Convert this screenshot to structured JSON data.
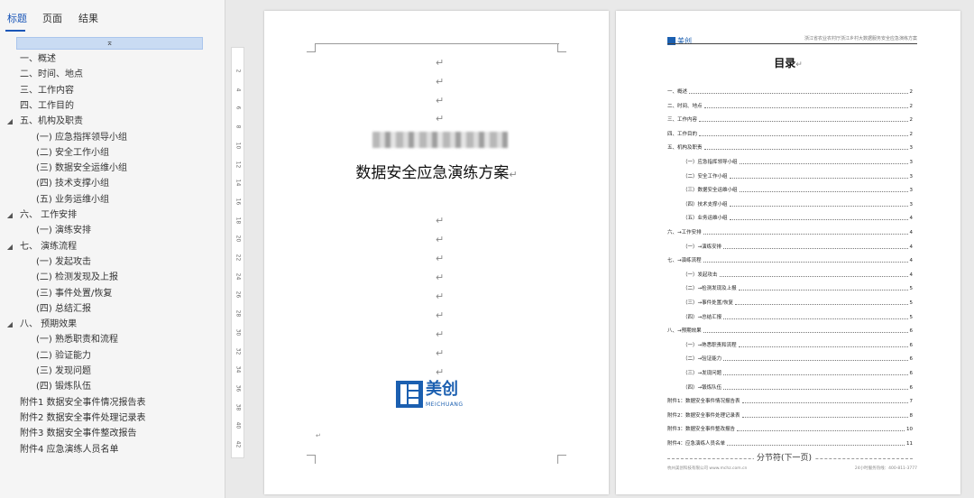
{
  "nav": {
    "tabs": [
      {
        "label": "标题",
        "active": true
      },
      {
        "label": "页面",
        "active": false
      },
      {
        "label": "结果",
        "active": false
      }
    ],
    "collapse_label": "⌅",
    "items": [
      {
        "label": "一、概述",
        "level": 0,
        "arrow": ""
      },
      {
        "label": "二、时间、地点",
        "level": 0,
        "arrow": ""
      },
      {
        "label": "三、工作内容",
        "level": 0,
        "arrow": ""
      },
      {
        "label": "四、工作目的",
        "level": 0,
        "arrow": ""
      },
      {
        "label": "五、机构及职责",
        "level": 0,
        "arrow": "◢"
      },
      {
        "label": "(一) 应急指挥领导小组",
        "level": 1,
        "arrow": ""
      },
      {
        "label": "(二) 安全工作小组",
        "level": 1,
        "arrow": ""
      },
      {
        "label": "(三) 数据安全运维小组",
        "level": 1,
        "arrow": ""
      },
      {
        "label": "(四) 技术支撑小组",
        "level": 1,
        "arrow": ""
      },
      {
        "label": "(五) 业务运维小组",
        "level": 1,
        "arrow": ""
      },
      {
        "label": "六、 工作安排",
        "level": 0,
        "arrow": "◢"
      },
      {
        "label": "(一)  演练安排",
        "level": 1,
        "arrow": ""
      },
      {
        "label": "七、 演练流程",
        "level": 0,
        "arrow": "◢"
      },
      {
        "label": "(一) 发起攻击",
        "level": 1,
        "arrow": ""
      },
      {
        "label": "(二)  检测发现及上报",
        "level": 1,
        "arrow": ""
      },
      {
        "label": "(三)  事件处置/恢复",
        "level": 1,
        "arrow": ""
      },
      {
        "label": "(四)  总结汇报",
        "level": 1,
        "arrow": ""
      },
      {
        "label": "八、 预期效果",
        "level": 0,
        "arrow": "◢"
      },
      {
        "label": "(一)  熟悉职责和流程",
        "level": 1,
        "arrow": ""
      },
      {
        "label": "(二) 验证能力",
        "level": 1,
        "arrow": ""
      },
      {
        "label": "(三)  发现问题",
        "level": 1,
        "arrow": ""
      },
      {
        "label": "(四)  锻炼队伍",
        "level": 1,
        "arrow": ""
      },
      {
        "label": "附件1 数据安全事件情况报告表",
        "level": 0,
        "arrow": ""
      },
      {
        "label": "附件2 数据安全事件处理记录表",
        "level": 0,
        "arrow": ""
      },
      {
        "label": "附件3 数据安全事件整改报告",
        "level": 0,
        "arrow": ""
      },
      {
        "label": "附件4 应急演练人员名单",
        "level": 0,
        "arrow": ""
      }
    ]
  },
  "ruler": {
    "numbers": [
      "2",
      "4",
      "6",
      "8",
      "10",
      "12",
      "14",
      "16",
      "18",
      "20",
      "22",
      "24",
      "26",
      "28",
      "30",
      "32",
      "34",
      "36",
      "38",
      "40",
      "42"
    ]
  },
  "page1": {
    "para_mark": "↵",
    "title": "数据安全应急演练方案",
    "logo_text": "美创",
    "logo_sub": "MEICHUANG"
  },
  "page2": {
    "logo_text": "美创",
    "header_text": "浙江省农业农村厅浙江乡村大数据服务安全应急演练方案",
    "toc_title": "目录",
    "toc": [
      {
        "label": "一、概述",
        "page": "2"
      },
      {
        "label": "二、时间、地点",
        "page": "2"
      },
      {
        "label": "三、工作内容",
        "page": "2"
      },
      {
        "label": "四、工作目的",
        "page": "2"
      },
      {
        "label": "五、机构及职责",
        "page": "3"
      },
      {
        "label": "（一）应急指挥领导小组",
        "page": "3"
      },
      {
        "label": "（二）安全工作小组",
        "page": "3"
      },
      {
        "label": "（三）数据安全运维小组",
        "page": "3"
      },
      {
        "label": "（四）技术支撑小组",
        "page": "3"
      },
      {
        "label": "（五）业务运维小组",
        "page": "4"
      },
      {
        "label": "六、→工作安排",
        "page": "4"
      },
      {
        "label": "（一）→演练安排",
        "page": "4"
      },
      {
        "label": "七、→演练流程",
        "page": "4"
      },
      {
        "label": "（一）发起攻击",
        "page": "4"
      },
      {
        "label": "（二）→检测发现及上报",
        "page": "5"
      },
      {
        "label": "（三）→事件处置/恢复",
        "page": "5"
      },
      {
        "label": "（四）→总结汇报",
        "page": "5"
      },
      {
        "label": "八、→预期效果",
        "page": "6"
      },
      {
        "label": "（一）→熟悉职责和流程",
        "page": "6"
      },
      {
        "label": "（二）→验证能力",
        "page": "6"
      },
      {
        "label": "（三）→发现问题",
        "page": "6"
      },
      {
        "label": "（四）→锻炼队伍",
        "page": "6"
      },
      {
        "label": "附件1：数据安全事件情况报告表",
        "page": "7"
      },
      {
        "label": "附件2：数据安全事件处理记录表",
        "page": "8"
      },
      {
        "label": "附件3：数据安全事件整改报告",
        "page": "10"
      },
      {
        "label": "附件4：应急演练人员名单",
        "page": "11"
      }
    ],
    "section_break": "分节符(下一页)",
    "footer_left": "杭州美创科技有限公司 www.mchz.com.cn",
    "footer_right": "24小时服务热线：400-811-3777"
  }
}
